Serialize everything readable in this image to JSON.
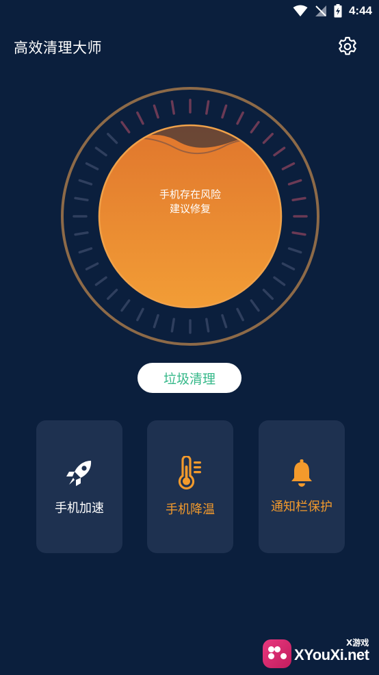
{
  "status_bar": {
    "time": "4:44"
  },
  "header": {
    "title": "高效清理大师"
  },
  "gauge": {
    "line1": "手机存在风险",
    "line2": "建议修复",
    "colors": {
      "fill_top": "#e07a2e",
      "fill_bottom": "#f09a36",
      "ring": "#8d6a48"
    }
  },
  "clean_button": {
    "label": "垃圾清理"
  },
  "cards": [
    {
      "label": "手机加速",
      "icon": "rocket-icon"
    },
    {
      "label": "手机降温",
      "icon": "thermometer-icon"
    },
    {
      "label": "通知栏保护",
      "icon": "bell-icon"
    }
  ],
  "colors": {
    "background": "#0b1f3d",
    "card": "#1e3150",
    "accent_green": "#35b889",
    "accent_orange": "#f39a2c"
  },
  "watermark": {
    "site": "XYouXi.net",
    "tag": "X游戏"
  }
}
